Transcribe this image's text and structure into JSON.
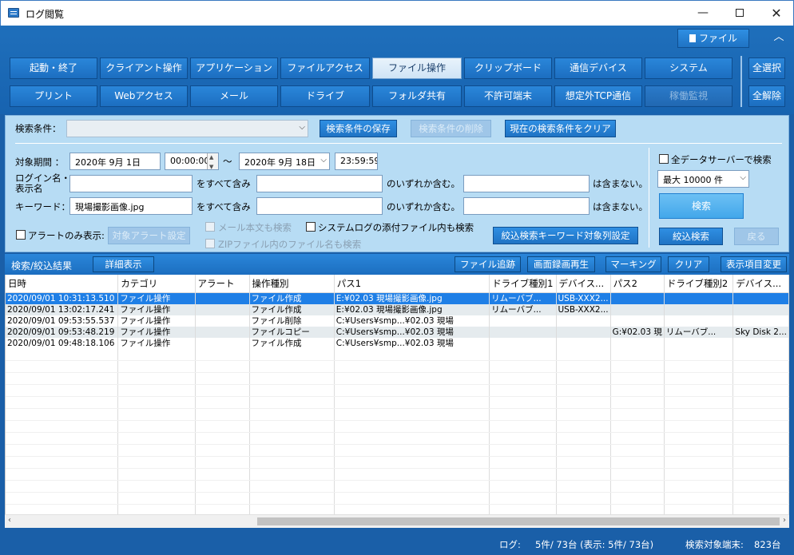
{
  "window": {
    "title": "ログ閲覧",
    "min": "—",
    "close": "✕"
  },
  "header": {
    "file_button": "ファイル",
    "collapse": "︿"
  },
  "categories_row1": [
    "起動・終了",
    "クライアント操作",
    "アプリケーション",
    "ファイルアクセス",
    "ファイル操作",
    "クリップボード",
    "通信デバイス",
    "システム"
  ],
  "categories_row2": [
    "プリント",
    "Webアクセス",
    "メール",
    "ドライブ",
    "フォルダ共有",
    "不許可端末",
    "想定外TCP通信",
    "稼働監視"
  ],
  "side": {
    "select_all": "全選択",
    "deselect_all": "全解除"
  },
  "search": {
    "condition_label": "検索条件：",
    "save_button": "検索条件の保存",
    "delete_button": "検索条件の削除",
    "clear_button": "現在の検索条件をクリア",
    "period_label": "対象期間 ：",
    "date_from": "2020年  9月  1日",
    "time_from": "00:00:00",
    "tilde": "～",
    "date_to": "2020年  9月 18日",
    "time_to": "23:59:59",
    "login_label_1": "ログイン名・",
    "login_label_2": "表示名",
    "keyword_label": "キーワード：",
    "keyword_value": "現場撮影画像.jpg",
    "and_text": "をすべて含み",
    "or_text": "のいずれか含む。",
    "not_text": "は含まない。",
    "alert_only": "アラートのみ表示:",
    "alert_settings": "対象アラート設定",
    "mail_body": "メール本文も検索",
    "syslog_attach": "システムログの添付ファイル内も検索",
    "zip_names": "ZIPファイル内のファイル名も検索",
    "refine_columns": "絞込検索キーワード対象列設定",
    "all_servers": "全データサーバーで検索",
    "max_count": "最大 10000 件",
    "search_button": "検索",
    "refine_button": "絞込検索",
    "back_button": "戻る"
  },
  "results": {
    "title": "検索/絞込結果",
    "detail_button": "詳細表示",
    "buttons": [
      "ファイル追跡",
      "画面録画再生",
      "マーキング",
      "クリア",
      "表示項目変更"
    ],
    "columns": [
      "日時",
      "カテゴリ",
      "アラート",
      "操作種別",
      "パス1",
      "ドライブ種別1",
      "デバイス...",
      "パス2",
      "ドライブ種別2",
      "デバイス..."
    ],
    "rows": [
      [
        "2020/09/01 10:31:13.510",
        "ファイル操作",
        "",
        "ファイル作成",
        "E:¥02.03 現場撮影画像.jpg",
        "リムーバブ...",
        "USB-XXX2...",
        "",
        "",
        ""
      ],
      [
        "2020/09/01 13:02:17.241",
        "ファイル操作",
        "",
        "ファイル作成",
        "E:¥02.03 現場撮影画像.jpg",
        "リムーバブ...",
        "USB-XXX2...",
        "",
        "",
        ""
      ],
      [
        "2020/09/01 09:53:55.537",
        "ファイル操作",
        "",
        "ファイル削除",
        "C:¥Users¥smp...¥02.03 現場",
        "",
        "",
        "",
        "",
        ""
      ],
      [
        "2020/09/01 09:53:48.219",
        "ファイル操作",
        "",
        "ファイルコピー",
        "C:¥Users¥smp...¥02.03 現場",
        "",
        "",
        "G:¥02.03 現",
        "リムーバブ...",
        "Sky Disk 2..."
      ],
      [
        "2020/09/01 09:48:18.106",
        "ファイル操作",
        "",
        "ファイル作成",
        "C:¥Users¥smp...¥02.03 現場",
        "",
        "",
        "",
        "",
        ""
      ]
    ]
  },
  "status": {
    "log_label": "ログ:",
    "log_value": "5件/  73台 (表示:   5件/  73台)",
    "target_label": "検索対象端末:",
    "target_value": "823台"
  }
}
